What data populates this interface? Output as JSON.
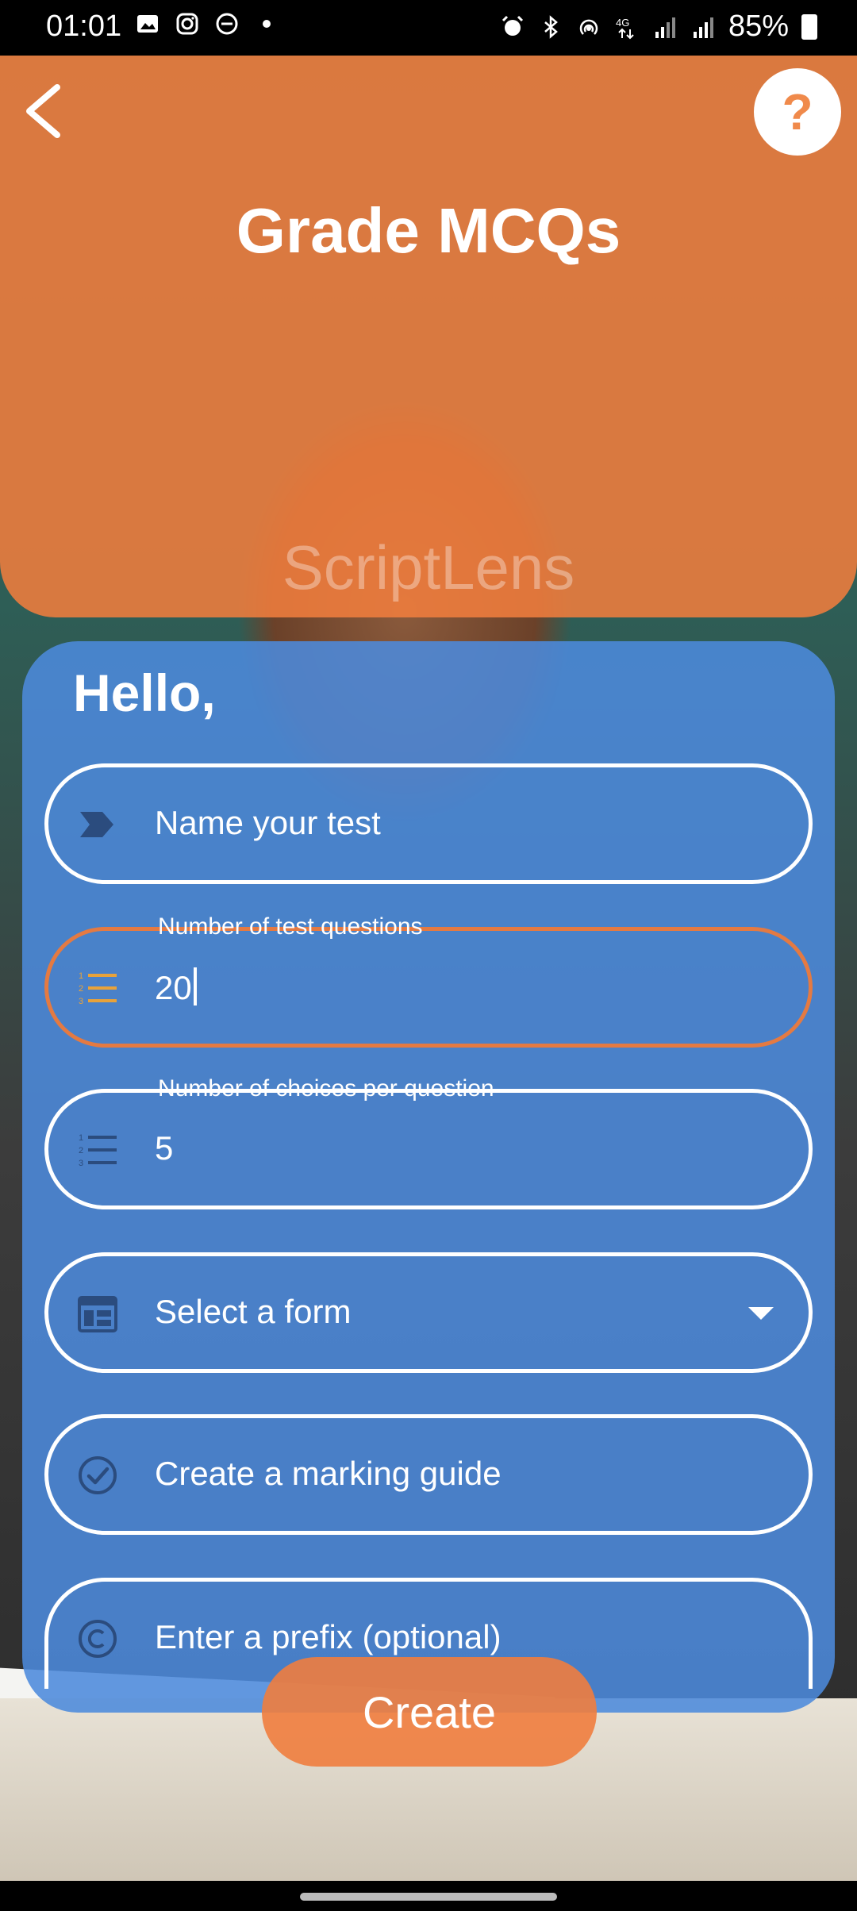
{
  "status_bar": {
    "time": "01:01",
    "battery": "85%",
    "left_icons": [
      "gallery-icon",
      "instagram-icon",
      "dnd-icon",
      "dot-icon"
    ],
    "right_icons": [
      "alarm-icon",
      "bluetooth-icon",
      "hotspot-icon",
      "4g-icon",
      "signal-icon",
      "signal-icon",
      "battery-charging-icon"
    ]
  },
  "header": {
    "title": "Grade MCQs",
    "brand": "ScriptLens",
    "help_label": "?",
    "accent_color": "#F07D3E"
  },
  "form": {
    "greeting": "Hello,",
    "card_color": "#4C8ADC",
    "fields": [
      {
        "placeholder": "Name your test",
        "legend": "",
        "value": "",
        "icon": "label-arrow-icon"
      },
      {
        "placeholder": "",
        "legend": "Number of test questions",
        "value": "20",
        "icon": "numbered-list-icon",
        "active": true
      },
      {
        "placeholder": "",
        "legend": "Number of choices per question",
        "value": "5",
        "icon": "numbered-list-icon"
      },
      {
        "placeholder": "Select a form",
        "legend": "",
        "value": "",
        "icon": "form-icon"
      },
      {
        "placeholder": "Create a marking guide",
        "legend": "",
        "value": "",
        "icon": "check-circle-icon"
      },
      {
        "placeholder": "Enter a prefix (optional)",
        "legend": "",
        "value": "",
        "icon": "copyright-icon"
      }
    ],
    "create_label": "Create"
  }
}
